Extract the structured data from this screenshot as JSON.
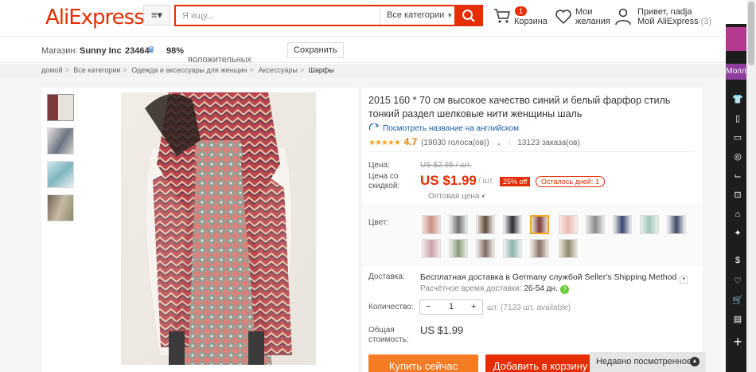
{
  "header": {
    "logo": "AliExpress",
    "menu_icon": "menu-icon",
    "search_placeholder": "Я ищу...",
    "search_category": "Все категории",
    "cart_count": "1",
    "cart_label": "Корзина",
    "wishlist_label_1": "Мои",
    "wishlist_label_2": "желания",
    "user_greeting": "Привет, nadja",
    "user_account": "Мой AliExpress",
    "user_count": "(3)"
  },
  "store": {
    "store_label": "Магазин:",
    "store_name": "Sunny Inc",
    "store_score": "23464",
    "positive_pct": "98%",
    "positive_label": "положительных отзывов",
    "save_label": "Сохранить"
  },
  "breadcrumbs": [
    "домой",
    "Все категории",
    "Одежда и аксессуары для женщин",
    "Аксессуары",
    "Шарфы"
  ],
  "product": {
    "title": "2015 160 * 70 см высокое качество синий и белый фарфор стиль тонкий раздел шелковые нити женщины шаль",
    "translate_link": "Посмотреть название на английском",
    "stars": "★★★★★",
    "rating": "4.7",
    "votes": "(19030 голоса(ов))",
    "orders": "13123 заказа(ов)",
    "price_label": "Цена:",
    "old_price": "US $2.65 / шт.",
    "sale_label_1": "Цена со",
    "sale_label_2": "скидкой:",
    "price": "US $1.99",
    "price_unit": "/ шт.",
    "discount": "25% off",
    "days_left": "Осталось дней: 1",
    "wholesale": "Оптовая цена",
    "color_label": "Цвет:",
    "shipping_label": "Доставка:",
    "shipping_method": "Бесплатная доставка в Germany службой Seller's Shipping Method",
    "delivery_time_label": "Расчётное время доставки:",
    "delivery_time": "26-54 дн.",
    "quantity_label": "Количество:",
    "quantity": "1",
    "available": "шт. (7133 шт. available)",
    "total_label_1": "Общая",
    "total_label_2": "стоимость:",
    "total": "US $1.99",
    "buy_now": "Купить сейчас",
    "add_to_cart": "Добавить в корзину"
  },
  "recently_viewed": "Недавно посмотренное",
  "sidebar": {
    "mall_label": "Молл"
  }
}
